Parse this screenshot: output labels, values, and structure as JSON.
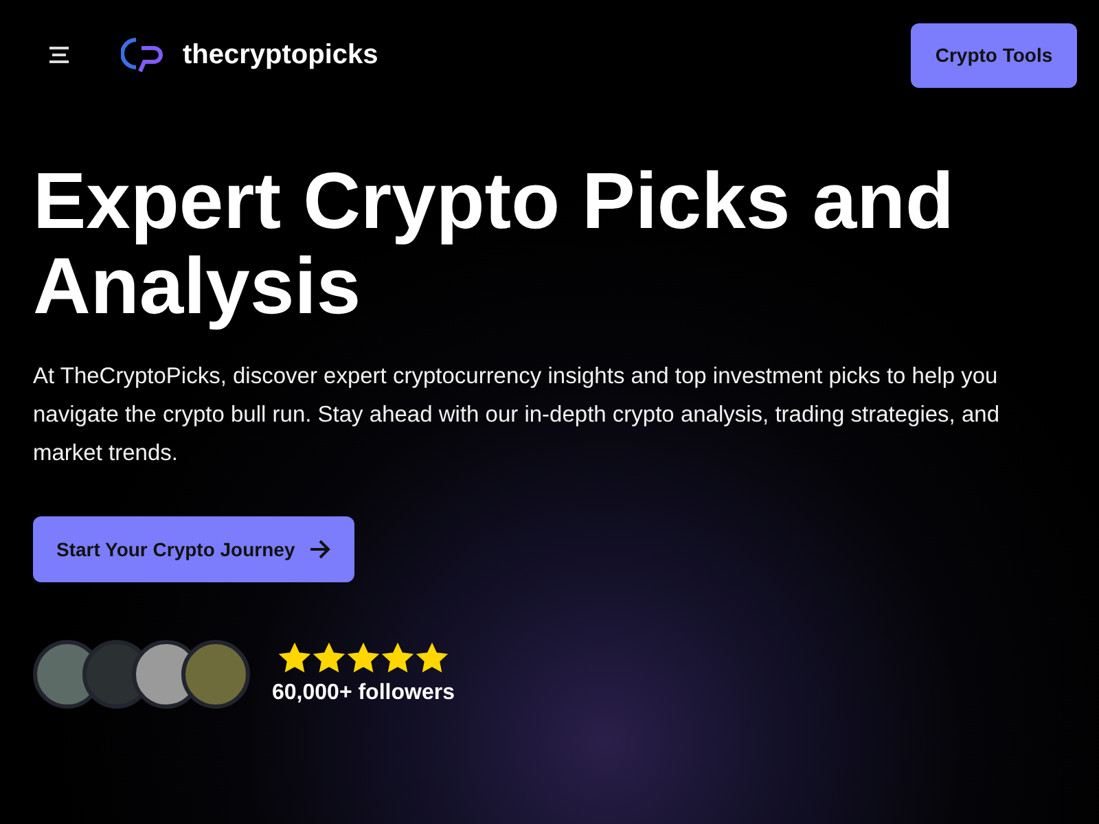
{
  "header": {
    "brand": "thecryptopicks",
    "cta": "Crypto Tools"
  },
  "hero": {
    "title": "Expert Crypto Picks and Analysis",
    "description": "At TheCryptoPicks, discover expert cryptocurrency insights and top investment picks to help you navigate the crypto bull run. Stay ahead with our in-depth crypto analysis, trading strategies, and market trends.",
    "button": "Start Your Crypto Journey"
  },
  "social_proof": {
    "stars": 5,
    "followers": "60,000+ followers"
  }
}
